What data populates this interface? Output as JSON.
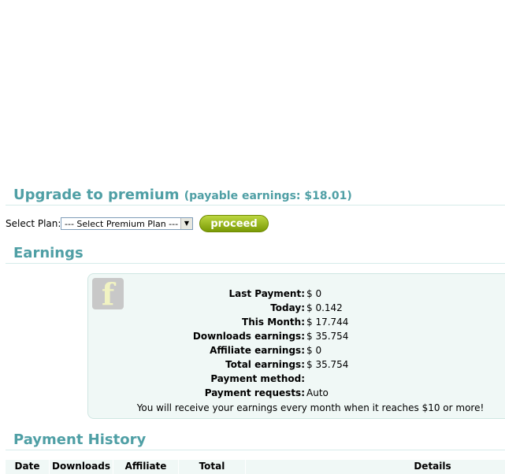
{
  "upgrade": {
    "title": "Upgrade to premium",
    "subtitle": "(payable earnings: $18.01)",
    "plan_label": "Select Plan:",
    "plan_selected": "--- Select Premium Plan ---",
    "proceed_label": "proceed"
  },
  "earnings": {
    "title": "Earnings",
    "icon": "facebook-icon",
    "rows": [
      {
        "label": "Last Payment:",
        "value": "$ 0"
      },
      {
        "label": "Today:",
        "value": "$ 0.142"
      },
      {
        "label": "This Month:",
        "value": "$ 17.744"
      },
      {
        "label": "Downloads earnings:",
        "value": "$ 35.754"
      },
      {
        "label": "Affiliate earnings:",
        "value": "$ 0"
      },
      {
        "label": "Total earnings:",
        "value": "$ 35.754"
      },
      {
        "label": "Payment method:",
        "value": ""
      },
      {
        "label": "Payment requests:",
        "value": "Auto"
      }
    ],
    "note": "You will receive your earnings every month when it reaches $10 or more!"
  },
  "history": {
    "title": "Payment History",
    "columns": [
      "Date",
      "Downloads",
      "Affiliate",
      "Total",
      "Details"
    ]
  },
  "colors": {
    "heading": "#4f9fa5",
    "box_bg": "#f0f8f6",
    "proceed_bg": "#8fb01a"
  }
}
